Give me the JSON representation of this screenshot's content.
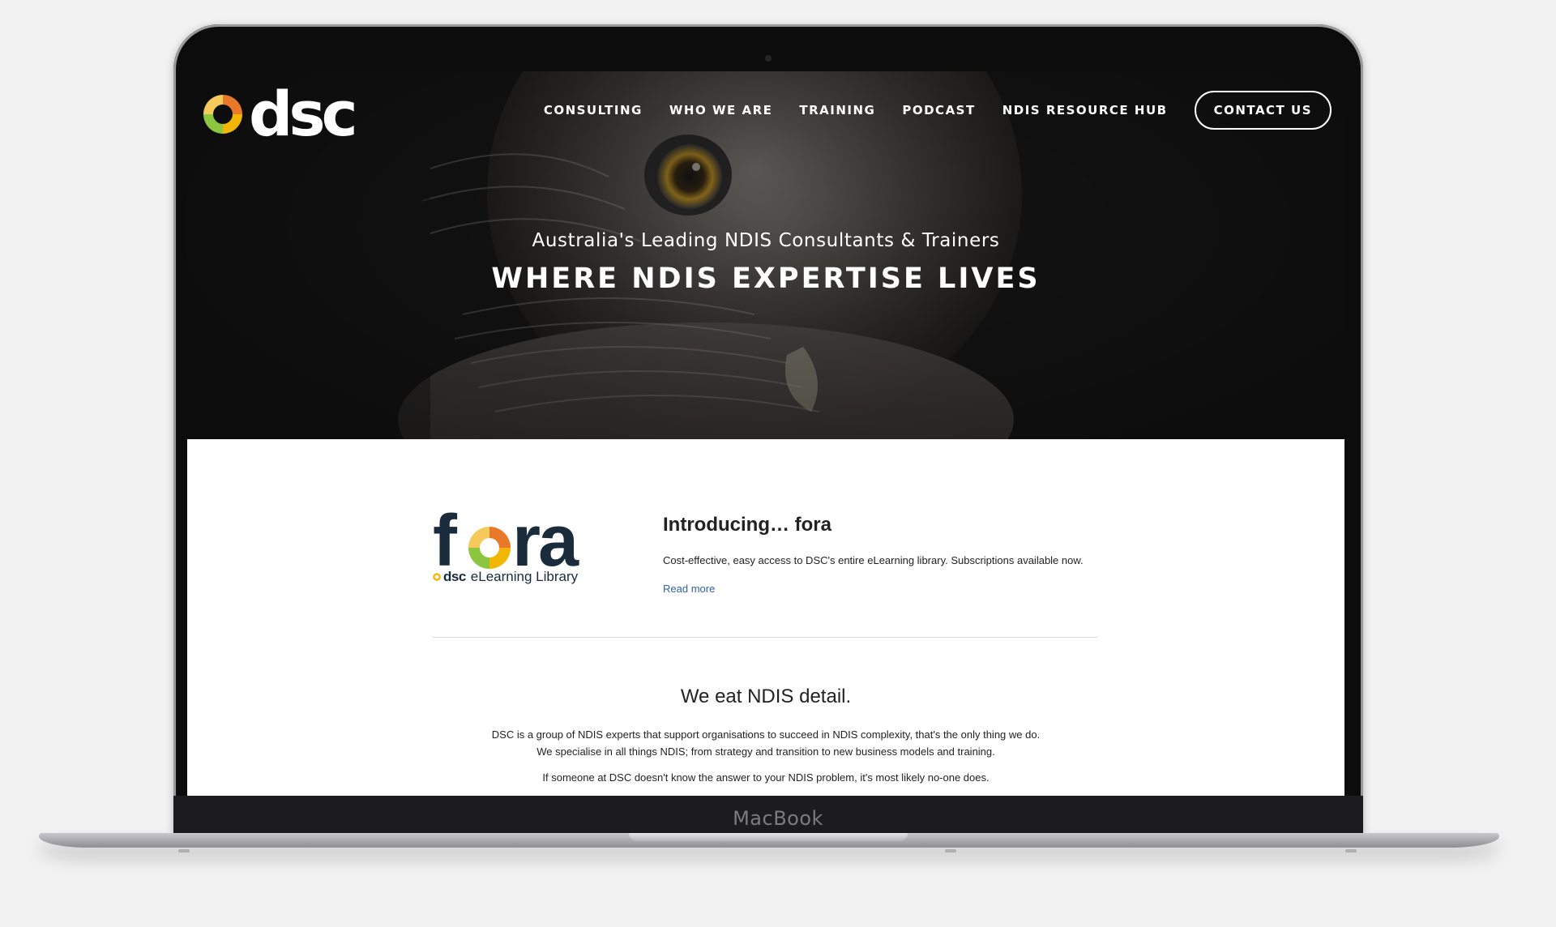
{
  "device": {
    "brand_label": "MacBook"
  },
  "header": {
    "logo_text": "dsc",
    "nav": [
      {
        "label": "CONSULTING"
      },
      {
        "label": "WHO WE ARE"
      },
      {
        "label": "TRAINING"
      },
      {
        "label": "PODCAST"
      },
      {
        "label": "NDIS RESOURCE HUB"
      }
    ],
    "cta_label": "CONTACT US"
  },
  "hero": {
    "subtitle": "Australia's Leading NDIS Consultants & Trainers",
    "title": "WHERE NDIS EXPERTISE LIVES"
  },
  "fora": {
    "logo_word": "fora",
    "logo_brand": "dsc",
    "logo_tagline": "eLearning Library",
    "heading_prefix": "Introducing… ",
    "heading_bold": "fora",
    "description": "Cost-effective, easy access to DSC's entire eLearning library. Subscriptions available now.",
    "link_label": "Read more"
  },
  "about": {
    "heading": "We eat NDIS detail.",
    "paragraph_1": "DSC is a group of NDIS experts that support organisations to succeed in NDIS complexity, that's the only thing we do. We specialise in all things NDIS; from strategy and transition to new business models and training.",
    "paragraph_2": "If someone at DSC doesn't know the answer to your NDIS problem, it's most likely no-one does."
  },
  "colors": {
    "logo_yellow": "#f2b705",
    "logo_orange": "#e8782a",
    "logo_green": "#8cc63f",
    "fora_navy": "#1a2b3c",
    "link_blue": "#2c62a8",
    "hero_dark": "#141414"
  },
  "icons": [
    "dsc-logo-ring-icon",
    "fora-ring-icon"
  ]
}
